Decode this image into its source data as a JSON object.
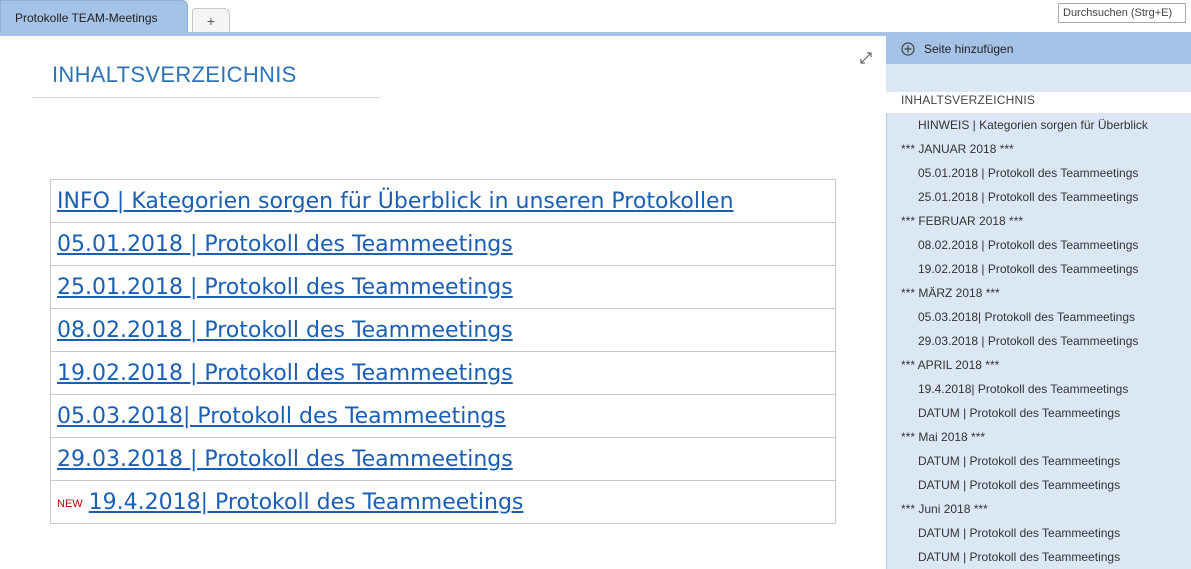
{
  "tabs": {
    "active_label": "Protokolle TEAM-Meetings",
    "add_label": "+"
  },
  "search": {
    "placeholder": "Durchsuchen (Strg+E)"
  },
  "page": {
    "title": "INHALTSVERZEICHNIS",
    "links": [
      {
        "label": "INFO | Kategorien sorgen für Überblick in unseren Protokollen",
        "badge": ""
      },
      {
        "label": "05.01.2018 | Protokoll des Teammeetings",
        "badge": ""
      },
      {
        "label": "25.01.2018 | Protokoll des Teammeetings",
        "badge": ""
      },
      {
        "label": "08.02.2018 | Protokoll des Teammeetings",
        "badge": ""
      },
      {
        "label": "19.02.2018 | Protokoll des Teammeetings",
        "badge": ""
      },
      {
        "label": "05.03.2018| Protokoll des Teammeetings",
        "badge": ""
      },
      {
        "label": "29.03.2018 | Protokoll des Teammeetings",
        "badge": ""
      },
      {
        "label": "19.4.2018| Protokoll des Teammeetings",
        "badge": "NEW"
      }
    ]
  },
  "pane": {
    "add_page_label": "Seite hinzufügen",
    "heading": "INHALTSVERZEICHNIS",
    "items": [
      {
        "label": "HINWEIS | Kategorien sorgen für Überblick",
        "level": 2
      },
      {
        "label": "*** JANUAR 2018 ***",
        "level": 1
      },
      {
        "label": "05.01.2018 | Protokoll des Teammeetings",
        "level": 2
      },
      {
        "label": "25.01.2018 | Protokoll des Teammeetings",
        "level": 2
      },
      {
        "label": "*** FEBRUAR 2018 ***",
        "level": 1
      },
      {
        "label": "08.02.2018 | Protokoll des Teammeetings",
        "level": 2
      },
      {
        "label": "19.02.2018 | Protokoll des Teammeetings",
        "level": 2
      },
      {
        "label": "*** MÄRZ 2018 ***",
        "level": 1
      },
      {
        "label": "05.03.2018| Protokoll des Teammeetings",
        "level": 2
      },
      {
        "label": "29.03.2018 | Protokoll des Teammeetings",
        "level": 2
      },
      {
        "label": "*** APRIL 2018 ***",
        "level": 1
      },
      {
        "label": "19.4.2018| Protokoll des Teammeetings",
        "level": 2
      },
      {
        "label": "DATUM | Protokoll des Teammeetings",
        "level": 2
      },
      {
        "label": "*** Mai 2018 ***",
        "level": 1
      },
      {
        "label": "DATUM | Protokoll des Teammeetings",
        "level": 2
      },
      {
        "label": "DATUM | Protokoll des Teammeetings",
        "level": 2
      },
      {
        "label": "*** Juni 2018 ***",
        "level": 1
      },
      {
        "label": "DATUM | Protokoll des Teammeetings",
        "level": 2
      },
      {
        "label": "DATUM | Protokoll des Teammeetings",
        "level": 2
      }
    ]
  },
  "icons": {
    "expand": "expand-icon",
    "add_page": "plus-circle-icon"
  },
  "colors": {
    "accent": "#a5c3e6",
    "pane_bg": "#dce7f5",
    "title": "#2e74b5",
    "link": "#1a5fb4",
    "new_badge": "#c00000"
  }
}
